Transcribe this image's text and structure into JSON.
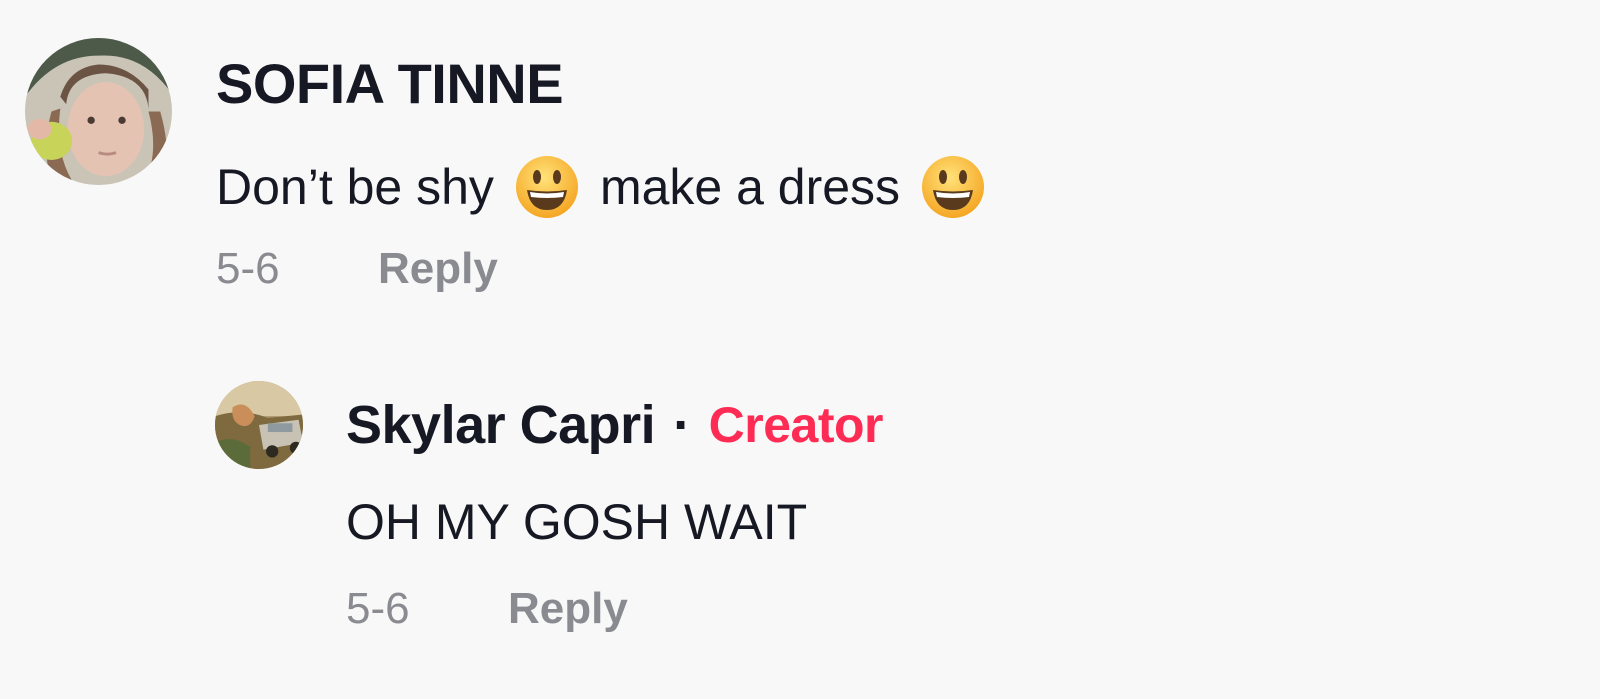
{
  "comments": [
    {
      "username": "SOFIA TINNE",
      "text_part1": "Don’t be shy",
      "emoji_1": "smiling-face-emoji",
      "text_part2": "make a dress",
      "emoji_2": "smiling-face-emoji",
      "date": "5-6",
      "reply_label": "Reply"
    },
    {
      "username": "Skylar Capri",
      "separator": "·",
      "badge": "Creator",
      "badge_color": "#fe2c55",
      "text": "OH MY GOSH WAIT",
      "date": "5-6",
      "reply_label": "Reply"
    }
  ],
  "colors": {
    "background": "#f8f8f8",
    "text_primary": "#161823",
    "text_secondary": "#8a8b91"
  }
}
